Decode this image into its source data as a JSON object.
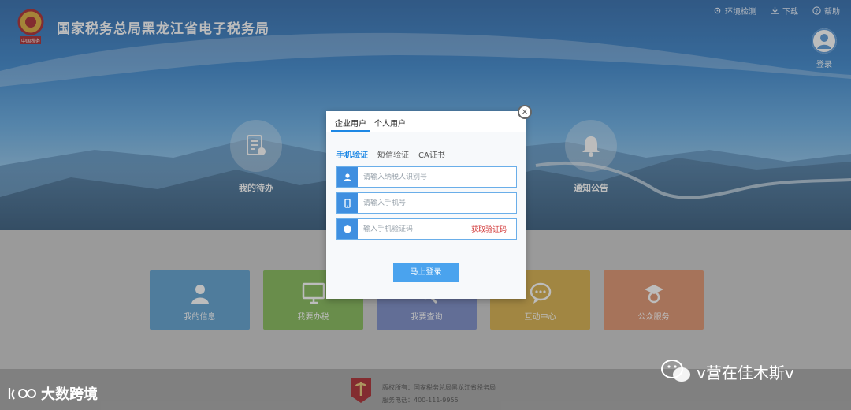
{
  "header": {
    "title": "国家税务总局黑龙江省电子税务局",
    "emblem_caption": "中国税务",
    "links": [
      {
        "label": "环境检测",
        "icon": "settings-icon"
      },
      {
        "label": "下载",
        "icon": "download-icon"
      },
      {
        "label": "帮助",
        "icon": "help-icon"
      }
    ],
    "login_label": "登录"
  },
  "hero": {
    "left_label": "我的待办",
    "right_label": "通知公告"
  },
  "tiles": [
    {
      "label": "我的信息",
      "color": "#4f98cc",
      "icon": "user-icon"
    },
    {
      "label": "我要办税",
      "color": "#7ab44a",
      "icon": "monitor-icon"
    },
    {
      "label": "我要查询",
      "color": "#6f82c2",
      "icon": "search-icon"
    },
    {
      "label": "互动中心",
      "color": "#d4a83a",
      "icon": "chat-icon"
    },
    {
      "label": "公众服务",
      "color": "#dc8a62",
      "icon": "service-icon"
    }
  ],
  "modal": {
    "user_tabs": [
      "企业用户",
      "个人用户"
    ],
    "auth_tabs": [
      "手机验证",
      "短信验证",
      "CA证书"
    ],
    "fields": {
      "taxpayer_id_placeholder": "请输入纳税人识别号",
      "phone_placeholder": "请输入手机号",
      "code_placeholder": "输入手机验证码"
    },
    "get_code_label": "获取验证码",
    "login_button": "马上登录",
    "close_symbol": "×"
  },
  "footer": {
    "copyright": "版权所有：国家税务总局黑龙江省税务局",
    "phone": "服务电话：400-111-9955"
  },
  "watermarks": {
    "left": "大数跨境",
    "right": "v营在佳木斯v"
  }
}
